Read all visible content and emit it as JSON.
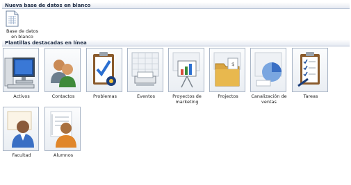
{
  "sections": {
    "new_blank": "Nueva base de datos en blanco",
    "featured": "Plantillas destacadas en línea"
  },
  "blank_db": {
    "label": "Base de datos en blanco",
    "icon": "blank-database-icon"
  },
  "templates": [
    {
      "label": "Activos",
      "icon": "computer-monitor-icon"
    },
    {
      "label": "Contactos",
      "icon": "people-icon"
    },
    {
      "label": "Problemas",
      "icon": "clipboard-check-icon"
    },
    {
      "label": "Eventos",
      "icon": "calendar-icon"
    },
    {
      "label": "Proyectos de marketing",
      "icon": "presentation-chart-icon"
    },
    {
      "label": "Projectos",
      "icon": "folder-icon"
    },
    {
      "label": "Canalización de ventas",
      "icon": "pie-chart-icon"
    },
    {
      "label": "Tareas",
      "icon": "task-clipboard-icon"
    },
    {
      "label": "Facultad",
      "icon": "teacher-icon"
    },
    {
      "label": "Alumnos",
      "icon": "student-icon"
    }
  ]
}
